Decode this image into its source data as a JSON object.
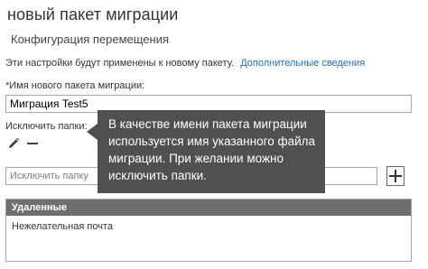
{
  "header": {
    "title": "новый пакет миграции",
    "subtitle": "Конфигурация перемещения"
  },
  "info": {
    "text": "Эти настройки будут применены к новому пакету.",
    "link_label": "Дополнительные сведения"
  },
  "name_field": {
    "label": "*Имя нового пакета миграции:",
    "value": "Миграция Test5"
  },
  "exclude": {
    "label": "Исключить папки:",
    "edit_icon": "pencil-icon",
    "remove_icon": "minus-icon",
    "folder_input_placeholder": "Исключить папку",
    "add_icon": "plus-icon"
  },
  "excluded_list": {
    "header": "Удаленные",
    "items": [
      "Нежелательная почта"
    ]
  },
  "tooltip": {
    "text": "В качестве имени пакета миграции используется имя указанного файла миграции. При желании можно исключить папки."
  },
  "colors": {
    "link": "#1f6fbf",
    "tooltip_bg": "#505050",
    "list_header_bg": "#6f6f6f"
  }
}
